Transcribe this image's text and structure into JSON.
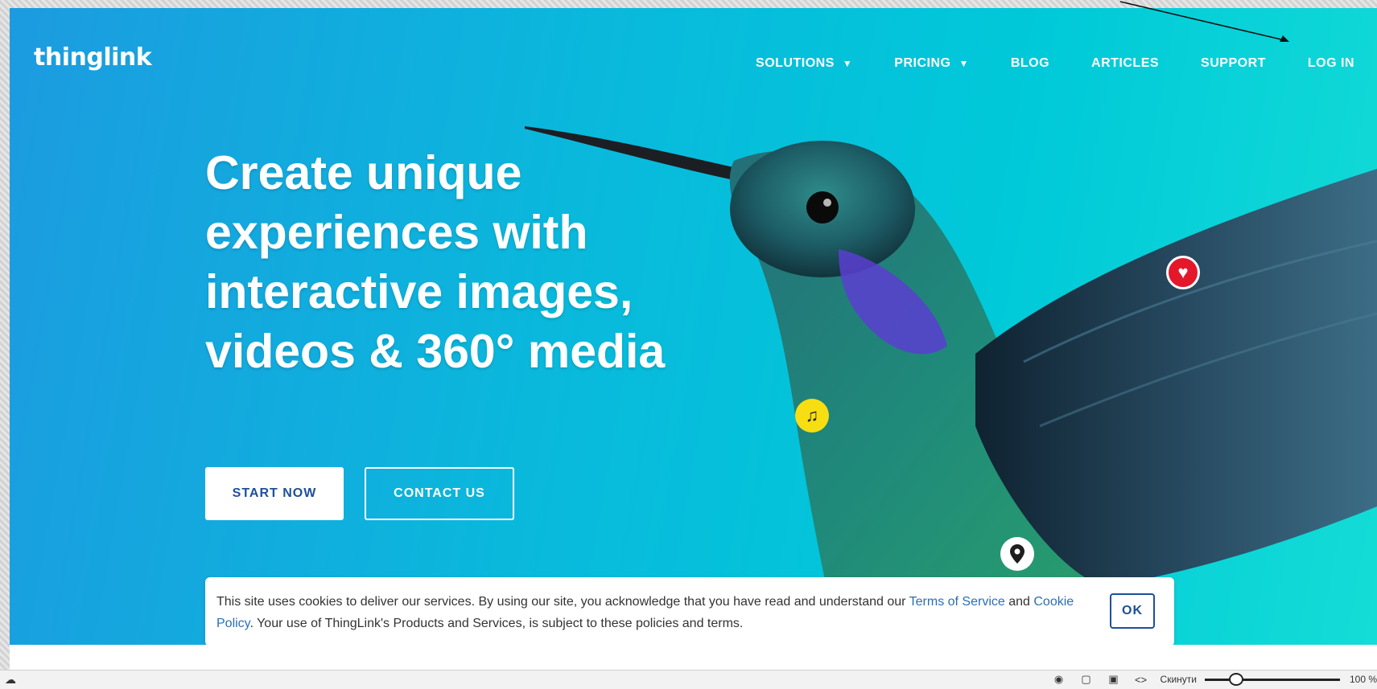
{
  "brand": {
    "logo": "thinglink"
  },
  "nav": {
    "items": [
      {
        "label": "SOLUTIONS",
        "dropdown": true
      },
      {
        "label": "PRICING",
        "dropdown": true
      },
      {
        "label": "BLOG",
        "dropdown": false
      },
      {
        "label": "ARTICLES",
        "dropdown": false
      },
      {
        "label": "SUPPORT",
        "dropdown": false
      },
      {
        "label": "LOG IN",
        "dropdown": false
      }
    ]
  },
  "hero": {
    "headline": "Create unique experiences with interactive images, videos & 360° media",
    "start_label": "START NOW",
    "contact_label": "CONTACT US",
    "tags": [
      "heart-icon",
      "music-note-icon",
      "map-pin-icon"
    ]
  },
  "cookie": {
    "text_before": "This site uses cookies to deliver our services. By using our site, you acknowledge that you have read and understand our ",
    "terms_link": "Terms of Service",
    "and_text": " and ",
    "cookie_link": "Cookie Policy",
    "text_after": ". Your use of ThingLink's Products and Services, is subject to these policies and terms.",
    "ok_label": "OK"
  },
  "statusbar": {
    "zoom_label": "Скинути",
    "zoom_value": "100 %",
    "zoom_fraction": 0.2
  },
  "colors": {
    "hero_start": "#1c9be0",
    "hero_end": "#14dcd6",
    "button_text": "#1d4f9a",
    "link": "#2a6eb8",
    "heart_tag": "#e4182b",
    "music_tag": "#f6de12"
  }
}
